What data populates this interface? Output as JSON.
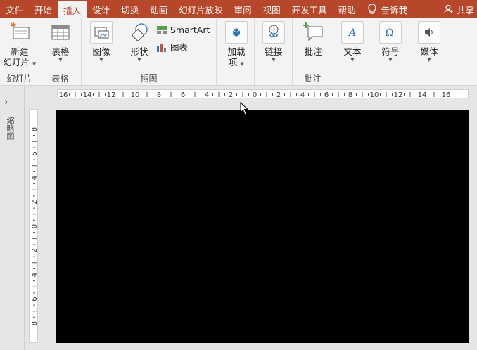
{
  "tabs": [
    {
      "label": "文件"
    },
    {
      "label": "开始"
    },
    {
      "label": "插入",
      "active": true
    },
    {
      "label": "设计"
    },
    {
      "label": "切换"
    },
    {
      "label": "动画"
    },
    {
      "label": "幻灯片放映"
    },
    {
      "label": "审阅"
    },
    {
      "label": "视图"
    },
    {
      "label": "开发工具"
    },
    {
      "label": "帮助"
    }
  ],
  "tell_me": "告诉我",
  "share": "共享",
  "ribbon": {
    "new_slide_line1": "新建",
    "new_slide_line2": "幻灯片",
    "group_slides": "幻灯片",
    "table": "表格",
    "group_tables": "表格",
    "image": "图像",
    "shapes": "形状",
    "smartart": "SmartArt",
    "chart": "图表",
    "group_illustrations": "插图",
    "addins_line1": "加载",
    "addins_line2": "项",
    "links": "链接",
    "comment": "批注",
    "group_comments": "批注",
    "text": "文本",
    "symbols": "符号",
    "media": "媒体"
  },
  "left_pane": {
    "label": "缩略图"
  },
  "ruler": {
    "h_labels": [
      "16",
      "14",
      "12",
      "10",
      "8",
      "6",
      "4",
      "2",
      "0",
      "2",
      "4",
      "6",
      "8",
      "10",
      "12",
      "14",
      "16"
    ],
    "v_labels": [
      "8",
      "6",
      "4",
      "2",
      "0",
      "2",
      "4",
      "6",
      "8"
    ]
  },
  "colors": {
    "accent": "#b7472a",
    "ribbon_bg": "#f3f3f3",
    "slide_bg": "#000000"
  }
}
